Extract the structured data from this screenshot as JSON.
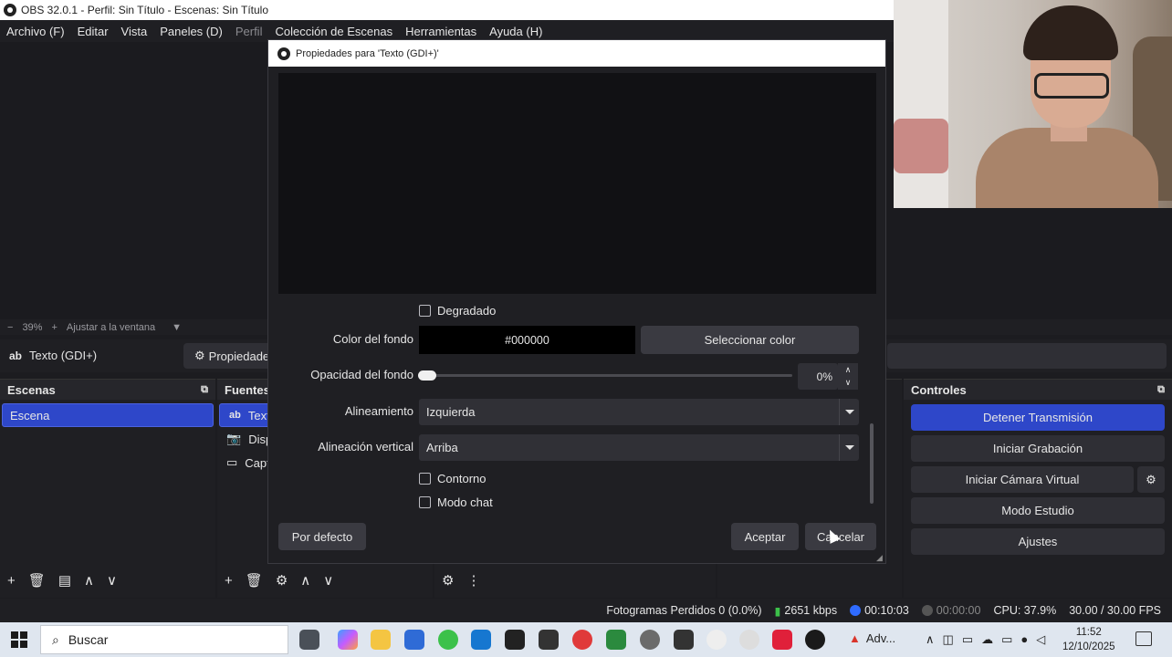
{
  "window": {
    "title": "OBS 32.0.1 - Perfil: Sin Título - Escenas: Sin Título"
  },
  "menu": {
    "items": [
      "Archivo (F)",
      "Editar",
      "Vista",
      "Paneles (D)",
      "Perfil",
      "Colección de Escenas",
      "Herramientas",
      "Ayuda (H)"
    ]
  },
  "zoom": {
    "minus": "−",
    "value": "39%",
    "plus": "+",
    "fit": "Ajustar a la ventana"
  },
  "source_bar": {
    "source_name": "Texto (GDI+)",
    "properties": "Propiedade"
  },
  "docks": {
    "scenes": {
      "title": "Escenas",
      "items": [
        "Escena"
      ]
    },
    "sources": {
      "title": "Fuentes",
      "items": [
        "Texto",
        "Disp",
        "Capt"
      ]
    },
    "controls": {
      "title": "Controles",
      "buttons": [
        "Detener Transmisión",
        "Iniciar Grabación",
        "Iniciar Cámara Virtual",
        "Modo Estudio",
        "Ajustes"
      ]
    }
  },
  "dialog": {
    "title": "Propiedades para 'Texto (GDI+)'",
    "gradient_label": "Degradado",
    "bg_color_label": "Color del fondo",
    "bg_color_value": "#000000",
    "select_color": "Seleccionar color",
    "bg_opacity_label": "Opacidad del fondo",
    "bg_opacity_value": "0%",
    "align_label": "Alineamiento",
    "align_value": "Izquierda",
    "valign_label": "Alineación vertical",
    "valign_value": "Arriba",
    "outline_label": "Contorno",
    "chat_label": "Modo chat",
    "defaults_button": "Por defecto",
    "accept_button": "Aceptar",
    "cancel_button": "Cancelar"
  },
  "status": {
    "dropped": "Fotogramas Perdidos 0 (0.0%)",
    "bitrate": "2651 kbps",
    "stream_time": "00:10:03",
    "rec_time": "00:00:00",
    "cpu": "CPU: 37.9%",
    "fps": "30.00 / 30.00 FPS"
  },
  "taskbar": {
    "search_placeholder": "Buscar",
    "notification_label": "Adv...",
    "time": "11:52",
    "date": "12/10/2025"
  },
  "colors": {
    "accent": "#2e47c9",
    "panel": "#1f1f23"
  }
}
